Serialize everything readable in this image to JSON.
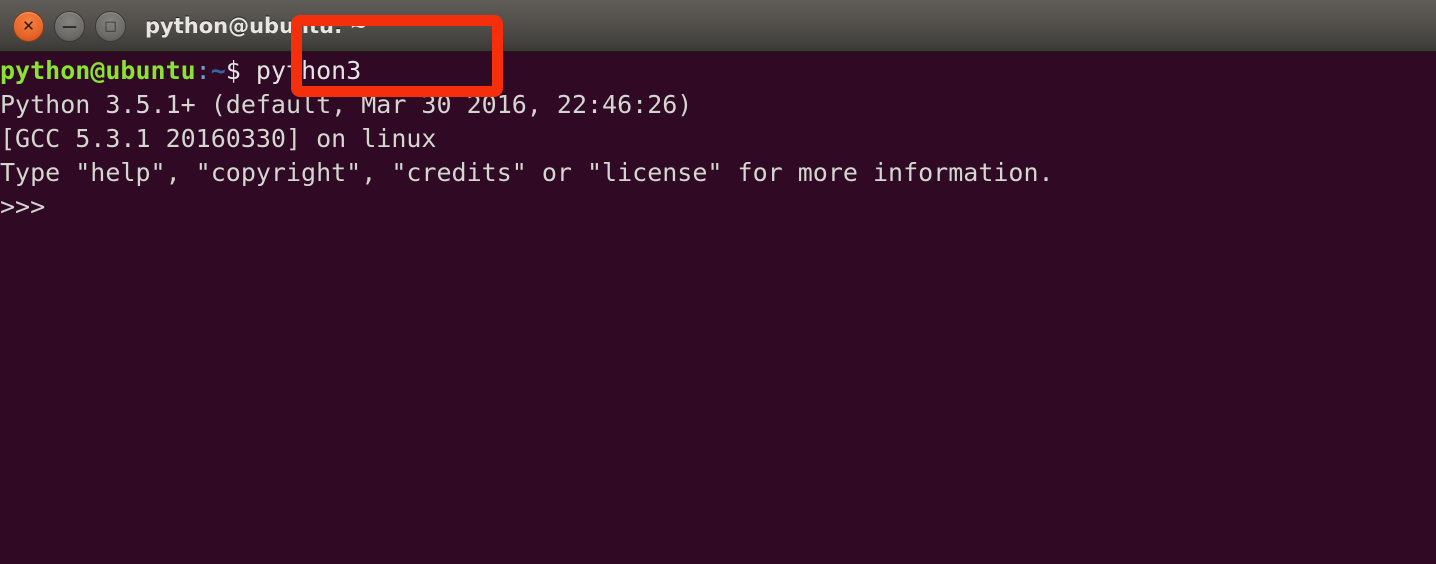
{
  "window": {
    "title": "python@ubuntu: ~",
    "controls": [
      {
        "name": "close",
        "glyph": "✕",
        "color": "#e8662b"
      },
      {
        "name": "minimize",
        "glyph": "—",
        "color": "#6e6c68"
      },
      {
        "name": "maximize",
        "glyph": "□",
        "color": "#6e6c68"
      }
    ]
  },
  "terminal": {
    "background_color": "#300a24",
    "foreground_color": "#d3d7cf",
    "prompt": {
      "user_host": "python@ubuntu",
      "separator": ":",
      "path": "~",
      "sigil": "$",
      "command": "python3"
    },
    "output_lines": [
      "Python 3.5.1+ (default, Mar 30 2016, 22:46:26)",
      "[GCC 5.3.1 20160330] on linux",
      "Type \"help\", \"copyright\", \"credits\" or \"license\" for more information."
    ],
    "python_prompt": ">>>"
  },
  "annotation": {
    "highlight_color": "#f52f0c",
    "target_text": "python3"
  }
}
